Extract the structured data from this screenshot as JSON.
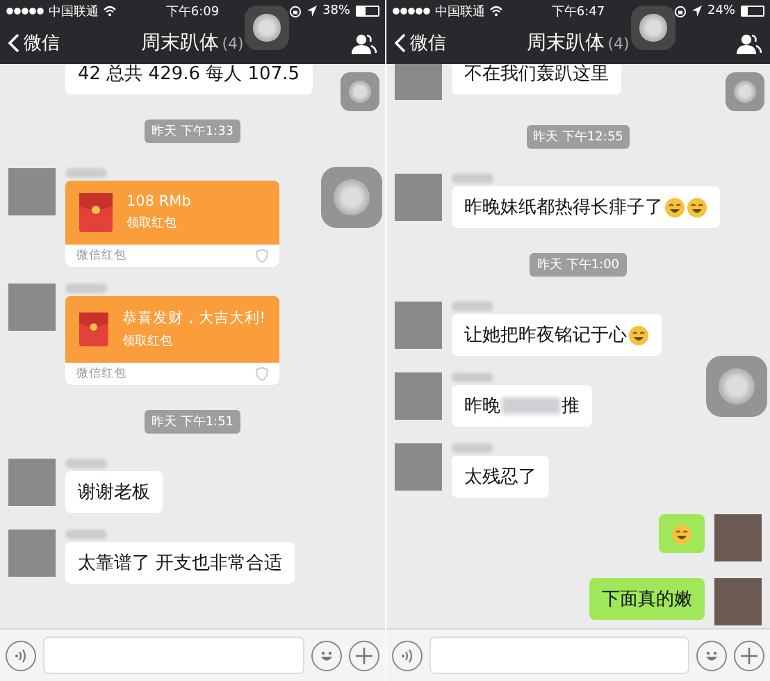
{
  "screens": [
    {
      "status_bar": {
        "carrier": "中国联通",
        "time": "下午6:09",
        "battery": "38%"
      },
      "nav": {
        "back": "微信",
        "title": "周末趴体",
        "count": "(4)"
      },
      "messages": [
        {
          "kind": "received_text",
          "avatar": false,
          "name_blurred": false,
          "cut": true,
          "parts": [
            {
              "kind": "text",
              "text": "42 总共 429.6 每人 107.5"
            }
          ]
        },
        {
          "kind": "time",
          "text": "昨天 下午1:33"
        },
        {
          "kind": "received_packet",
          "avatar": true,
          "name_blurred": true,
          "title": "108 RMb",
          "action": "领取红包",
          "footer": "微信红包"
        },
        {
          "kind": "received_packet",
          "avatar": true,
          "name_blurred": true,
          "title": "恭喜发财，大吉大利!",
          "action": "领取红包",
          "footer": "微信红包"
        },
        {
          "kind": "time",
          "text": "昨天 下午1:51"
        },
        {
          "kind": "received_text",
          "avatar": true,
          "name_blurred": true,
          "cut": false,
          "parts": [
            {
              "kind": "text",
              "text": "谢谢老板"
            }
          ]
        },
        {
          "kind": "received_text",
          "avatar": true,
          "name_blurred": true,
          "cut": false,
          "parts": [
            {
              "kind": "text",
              "text": "太靠谱了 开支也非常合适"
            }
          ]
        }
      ]
    },
    {
      "status_bar": {
        "carrier": "中国联通",
        "time": "下午6:47",
        "battery": "24%"
      },
      "nav": {
        "back": "微信",
        "title": "周末趴体",
        "count": "(4)"
      },
      "messages": [
        {
          "kind": "received_text",
          "avatar": true,
          "name_blurred": false,
          "cut": true,
          "parts": [
            {
              "kind": "text",
              "text": "不在我们轰趴这里"
            }
          ]
        },
        {
          "kind": "time",
          "text": "昨天 下午12:55"
        },
        {
          "kind": "received_text",
          "avatar": true,
          "name_blurred": true,
          "cut": false,
          "parts": [
            {
              "kind": "text",
              "text": "昨晚妹纸都热得长痱子了"
            },
            {
              "kind": "emoji"
            },
            {
              "kind": "emoji"
            }
          ]
        },
        {
          "kind": "time",
          "text": "昨天 下午1:00"
        },
        {
          "kind": "received_text",
          "avatar": true,
          "name_blurred": true,
          "cut": false,
          "parts": [
            {
              "kind": "text",
              "text": "让她把昨夜铭记于心"
            },
            {
              "kind": "emoji"
            }
          ]
        },
        {
          "kind": "received_text",
          "avatar": true,
          "name_blurred": true,
          "cut": false,
          "parts": [
            {
              "kind": "text",
              "text": "昨晚"
            },
            {
              "kind": "redacted"
            },
            {
              "kind": "text",
              "text": "推"
            }
          ]
        },
        {
          "kind": "received_text",
          "avatar": true,
          "name_blurred": true,
          "cut": false,
          "parts": [
            {
              "kind": "text",
              "text": "太残忍了"
            }
          ]
        },
        {
          "kind": "sent_text",
          "avatar": true,
          "name_blurred": false,
          "cut": false,
          "parts": [
            {
              "kind": "emoji"
            }
          ]
        },
        {
          "kind": "sent_text",
          "avatar": true,
          "name_blurred": false,
          "cut": false,
          "parts": [
            {
              "kind": "text",
              "text": "下面真的嫩"
            }
          ]
        }
      ]
    }
  ]
}
